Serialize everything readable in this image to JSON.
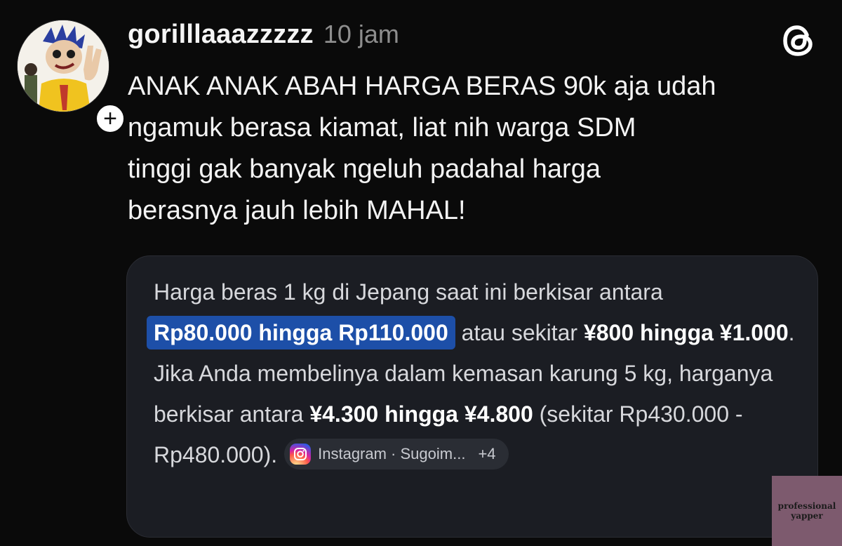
{
  "post": {
    "username": "gorilllaaazzzzz",
    "time": "10 jam",
    "text": "ANAK ANAK ABAH HARGA BERAS 90k aja udah\nngamuk berasa kiamat, liat nih warga SDM\ntinggi gak banyak ngeluh padahal harga\nberasnya jauh lebih MAHAL!",
    "follow_glyph": "+"
  },
  "card": {
    "seg1": "Harga beras 1 kg di Jepang saat ini berkisar antara ",
    "seg2_highlight": "Rp80.000 hingga Rp110.000",
    "seg3": " atau sekitar ",
    "seg4_bold": "¥800 hingga ¥1.000",
    "seg5": ". Jika Anda membelinya dalam kemasan karung 5 kg, harganya berkisar antara ",
    "seg6_bold": "¥4.300 hingga ¥4.800",
    "seg7": " (sekitar Rp430.000 - Rp480.000).",
    "source_label": "Instagram · Sugoim...",
    "source_more": "+4"
  },
  "watermark": {
    "line1": "professional",
    "line2": "yapper"
  },
  "icons": {
    "app_logo": "threads-icon",
    "source": "instagram-icon"
  },
  "colors": {
    "background": "#0a0a0a",
    "card": "#1b1d23",
    "highlight": "#1d4fa8",
    "muted": "#8e8e8e"
  }
}
